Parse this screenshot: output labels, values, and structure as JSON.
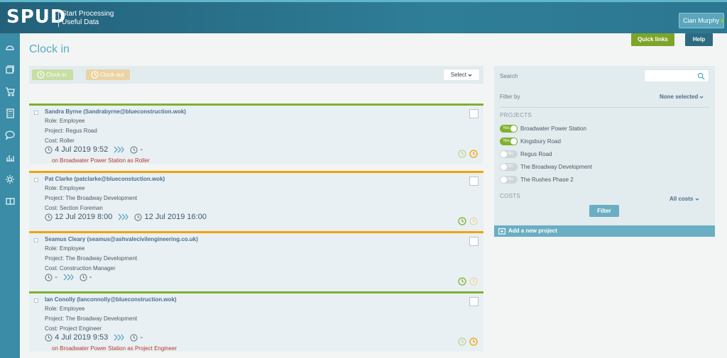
{
  "header": {
    "logo": "SPUD",
    "tagline_line1": "Start Processing",
    "tagline_line2": "Useful Data",
    "user": "Cian Murphy",
    "quick_links": "Quick links",
    "help": "Help"
  },
  "sidebar": {
    "icons": [
      "dashboard-icon",
      "documents-icon",
      "cart-icon",
      "calculator-icon",
      "chat-icon",
      "chart-icon",
      "settings-icon",
      "book-icon"
    ]
  },
  "page": {
    "title": "Clock in"
  },
  "toolbar": {
    "clock_in": "Clock in",
    "clock_out": "Clock out",
    "select": "Select"
  },
  "entries": [
    {
      "name": "Sandra Byrne (Sandrabyrne@blueconstruction.wok)",
      "role": "Role: Employee",
      "project": "Project: Regus Road",
      "cost": "Cost: Roller",
      "clock_in": "4 Jul 2019 9:52",
      "clock_out": "-",
      "location": "on Broadwater Power Station as Roller",
      "status_color": "#7fb02e"
    },
    {
      "name": "Pat Clarke (patclarke@blueconstuction.wok)",
      "role": "Role: Employee",
      "project": "Project: The Broadway Development",
      "cost": "Cost: Section Foreman",
      "clock_in": "12 Jul 2019 8:00",
      "clock_out": "12 Jul 2019 16:00",
      "location": "",
      "status_color": "#f2a20d"
    },
    {
      "name": "Seamus Cleary (seamus@ashvalecivilengineering.co.uk)",
      "role": "Role: Employee",
      "project": "Project: The Broadway Development",
      "cost": "Cost: Construction Manager",
      "clock_in": "-",
      "clock_out": "-",
      "location": "",
      "status_color": "#f2a20d"
    },
    {
      "name": "Ian Conolly (Ianconnolly@blueconstruction.wok)",
      "role": "Role: Employee",
      "project": "Project: The Broadway Development",
      "cost": "Cost: Project Engineer",
      "clock_in": "4 Jul 2019 9:53",
      "clock_out": "-",
      "location": "on Broadwater Power Station as Project Engineer",
      "status_color": "#7fb02e"
    }
  ],
  "filter_panel": {
    "search_label": "Search",
    "search_value": "",
    "filter_by_label": "Filter by",
    "filter_by_value": "None selected",
    "projects_heading": "PROJECTS",
    "projects": [
      {
        "toggle": "Yes",
        "name": "Broadwater Power Station",
        "on": true
      },
      {
        "toggle": "Yes",
        "name": "Kingsbury Road",
        "on": true
      },
      {
        "toggle": "No",
        "name": "Regus Road",
        "on": false
      },
      {
        "toggle": "No",
        "name": "The Broadway Development",
        "on": false
      },
      {
        "toggle": "No",
        "name": "The Rushes Phase 2",
        "on": false
      }
    ],
    "costs_heading": "COSTS",
    "costs_value": "All costs",
    "filter_button": "Filter",
    "add_project": "Add a new project"
  }
}
